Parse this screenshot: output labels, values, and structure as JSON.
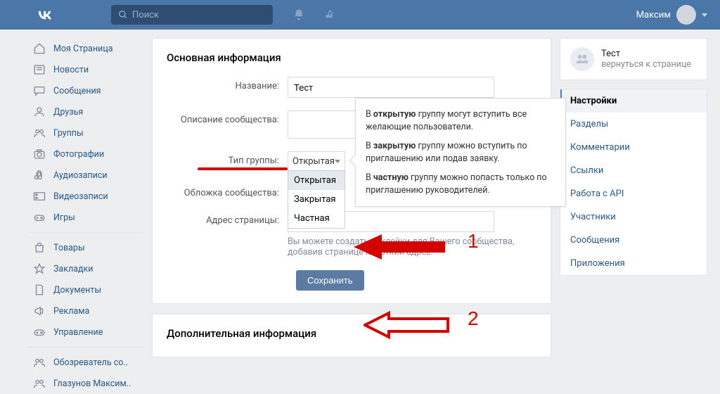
{
  "header": {
    "search_placeholder": "Поиск",
    "username": "Максим"
  },
  "sidebar": {
    "items": [
      {
        "label": "Моя Страница",
        "icon": "home"
      },
      {
        "label": "Новости",
        "icon": "news"
      },
      {
        "label": "Сообщения",
        "icon": "chat"
      },
      {
        "label": "Друзья",
        "icon": "user"
      },
      {
        "label": "Группы",
        "icon": "group"
      },
      {
        "label": "Фотографии",
        "icon": "camera"
      },
      {
        "label": "Аудиозаписи",
        "icon": "music"
      },
      {
        "label": "Видеозаписи",
        "icon": "video"
      },
      {
        "label": "Игры",
        "icon": "game"
      }
    ],
    "items2": [
      {
        "label": "Товары",
        "icon": "bag"
      },
      {
        "label": "Закладки",
        "icon": "star"
      },
      {
        "label": "Документы",
        "icon": "doc"
      },
      {
        "label": "Реклама",
        "icon": "ads"
      },
      {
        "label": "Управление",
        "icon": "game"
      }
    ],
    "items3": [
      {
        "label": "Обозреватель со..",
        "icon": "group"
      },
      {
        "label": "Глазунов Максим..",
        "icon": "group"
      }
    ]
  },
  "main": {
    "heading": "Основная информация",
    "heading2": "Дополнительная информация",
    "fields": {
      "name_label": "Название:",
      "name_value": "Тест",
      "desc_label": "Описание сообщества:",
      "type_label": "Тип группы:",
      "type_selected": "Открытая",
      "type_options": [
        "Открытая",
        "Закрытая",
        "Частная"
      ],
      "cover_label": "Обложка сообщества:",
      "address_label": "Адрес страницы:",
      "address_hint": "Вы можете создать наклейки для Вашего сообщества, добавив странице короткий адрес."
    },
    "tooltip": {
      "open_pre": "В ",
      "open_b": "открытую",
      "open_post": " группу могут вступить все желающие пользователи.",
      "closed_pre": "В ",
      "closed_b": "закрытую",
      "closed_post": " группу можно вступить по приглашению или подав заявку.",
      "private_pre": "В ",
      "private_b": "частную",
      "private_post": " группу можно попасть только по приглашению руководителей."
    },
    "save_button": "Сохранить"
  },
  "right": {
    "group_name": "Тест",
    "back_label": "вернуться к странице",
    "menu": [
      "Настройки",
      "Разделы",
      "Комментарии",
      "Ссылки",
      "Работа с API",
      "Участники",
      "Сообщения",
      "Приложения"
    ]
  },
  "annotations": {
    "n1": "1",
    "n2": "2"
  }
}
